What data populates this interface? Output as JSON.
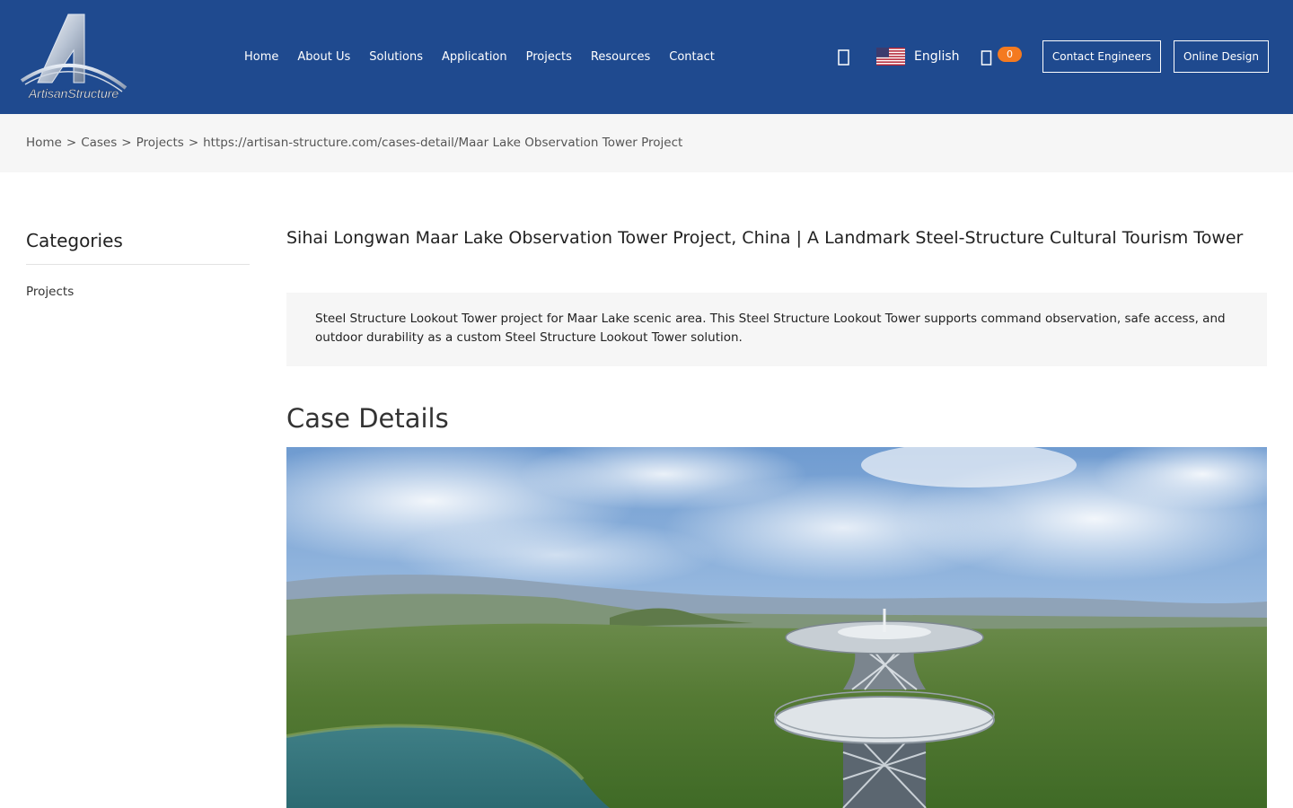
{
  "brand": {
    "logo_text": "ArtisanStructure"
  },
  "nav": {
    "items": [
      "Home",
      "About Us",
      "Solutions",
      "Application",
      "Projects",
      "Resources",
      "Contact"
    ]
  },
  "header": {
    "language": "English",
    "cart_count": "0",
    "contact_button": "Contact Engineers",
    "design_button": "Online Design"
  },
  "breadcrumb": {
    "items": [
      "Home",
      "Cases",
      "Projects",
      "https://artisan-structure.com/cases-detail/Maar Lake Observation Tower Project"
    ],
    "separator": ">"
  },
  "sidebar": {
    "title": "Categories",
    "items": [
      "Projects"
    ]
  },
  "main": {
    "title": "Sihai Longwan Maar Lake Observation Tower Project, China | A Landmark Steel-Structure Cultural Tourism Tower",
    "summary": "Steel Structure Lookout Tower project for Maar Lake scenic area. This Steel Structure Lookout Tower supports command observation, safe access, and outdoor durability as a custom Steel Structure Lookout Tower solution.",
    "section_title": "Case Details"
  },
  "colors": {
    "header_bg": "#1f4a8f",
    "badge": "#f47a20",
    "panel_bg": "#f6f6f6"
  },
  "icons": [
    "search-icon",
    "us-flag-icon",
    "cart-icon"
  ]
}
